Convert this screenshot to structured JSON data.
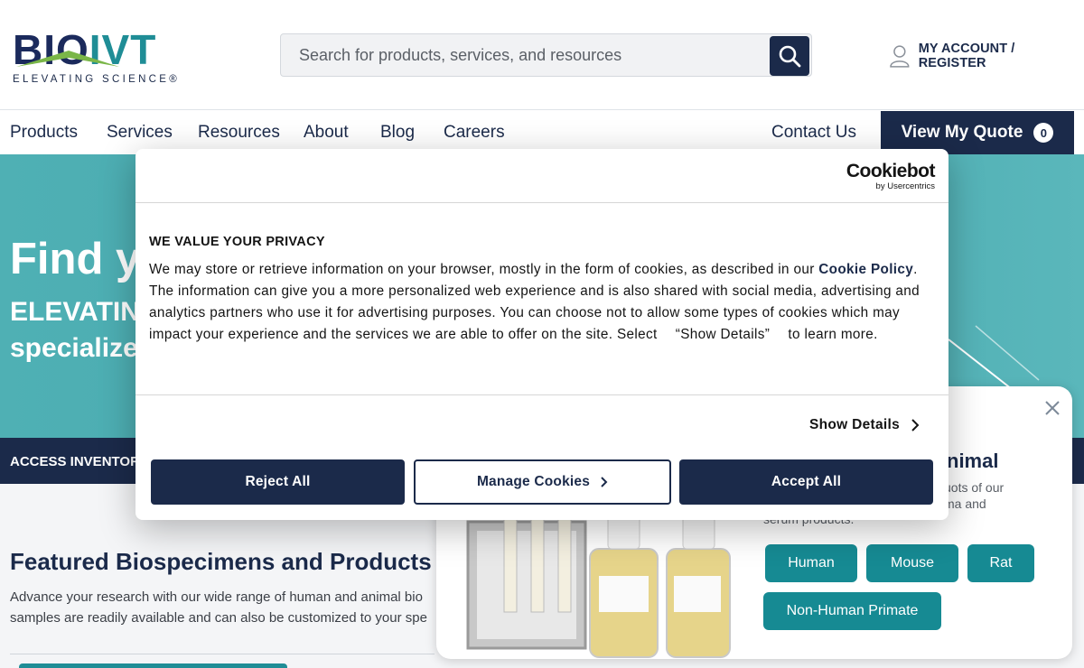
{
  "header": {
    "logo_bio": "BIO",
    "logo_ivt": "IVT",
    "logo_tagline": "ELEVATING SCIENCE®",
    "search_placeholder": "Search for products, services, and resources",
    "account_label": "MY ACCOUNT / REGISTER"
  },
  "nav": {
    "items": [
      "Products",
      "Services",
      "Resources",
      "About",
      "Blog",
      "Careers"
    ],
    "contact": "Contact Us",
    "quote_label": "View My Quote",
    "quote_count": "0"
  },
  "hero": {
    "title": "Find yo",
    "sub1": "ELEVATIN",
    "sub2": "specialized"
  },
  "access_bar": {
    "label": "ACCESS INVENTOR"
  },
  "featured": {
    "title": "Featured Biospecimens and Products",
    "p1": "Advance your research with our wide range of human and animal bio",
    "p2": "samples are readily available and can also be customized to your spe"
  },
  "promo": {
    "title": "nimal",
    "text1": "uots of our",
    "text2": "ma and",
    "text3": "serum products.",
    "buttons": [
      "Human",
      "Mouse",
      "Rat",
      "Non-Human Primate"
    ]
  },
  "cookie": {
    "brand": "Cookiebot",
    "brand_sub": "by Usercentrics",
    "heading": "WE VALUE YOUR PRIVACY",
    "body_before": "We may store or retrieve information on your browser, mostly in the form of cookies, as described in our ",
    "policy_link": "Cookie Policy",
    "body_after": ". The information can give you a more personalized web experience and is also shared with social media, advertising and analytics partners who use it for advertising purposes. You can choose not to allow some types of cookies which may impact your experience and the services we are able to offer on the site. Select 　“Show Details”　 to learn more.",
    "show_details": "Show Details",
    "reject": "Reject All",
    "manage": "Manage Cookies",
    "accept": "Accept All"
  },
  "colors": {
    "navy": "#1b2a4a",
    "teal": "#1f8d96",
    "hero_teal": "#4fb0b4",
    "button_teal": "#168a93"
  }
}
